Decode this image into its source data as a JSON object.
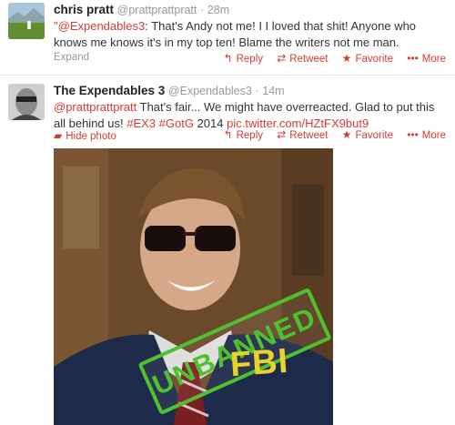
{
  "tweet1": {
    "name": "chris pratt",
    "handle": "@prattprattpratt",
    "dot": "·",
    "time": "28m",
    "quote_open": "\"",
    "mention": "@Expendables3",
    "text": ": That's Andy not me! I I loved that shit! Anyone who knows me knows it's in my top ten! Blame the writers not me man.",
    "expand": "Expand",
    "actions": {
      "reply": "Reply",
      "retweet": "Retweet",
      "favorite": "Favorite",
      "more": "More"
    }
  },
  "tweet2": {
    "name": "The Expendables 3",
    "handle": "@Expendables3",
    "dot": "·",
    "time": "14m",
    "mention": "@prattprattpratt",
    "text_a": " That's fair... We might have overreacted. Glad to put this all behind us! ",
    "hashtag1": "#EX3",
    "hashtag2": "#GotG",
    "text_b": " 2014 ",
    "pic_link": "pic.twitter.com/HZtFX9but9",
    "hide_photo": "Hide photo",
    "actions": {
      "reply": "Reply",
      "retweet": "Retweet",
      "favorite": "Favorite",
      "more": "More"
    },
    "photo": {
      "stamp": "UNBANNED",
      "jacket_text": "FBI"
    }
  },
  "colors": {
    "link": "#d23c33",
    "stamp": "#4fc12e",
    "jacket_text": "#e8d22b"
  },
  "icons": [
    "reply-icon",
    "retweet-icon",
    "favorite-icon",
    "more-icon",
    "media-icon"
  ]
}
